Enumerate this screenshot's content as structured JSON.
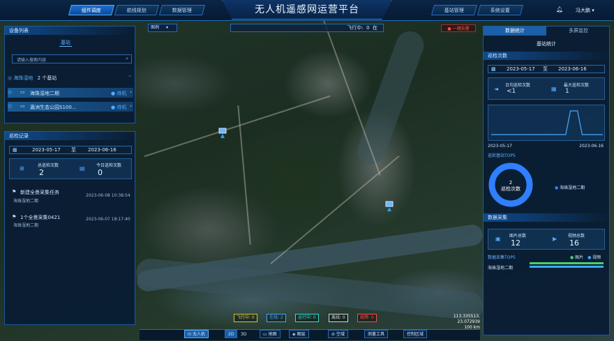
{
  "header": {
    "title": "无人机遥感网运营平台",
    "left_tabs": [
      "组件调度",
      "航线规划",
      "数据管理"
    ],
    "right_tabs": [
      "基站管理",
      "系统设置"
    ],
    "user": "冯大鹏"
  },
  "map_toolbar": {
    "layer_label": "图例",
    "flight_label": "飞行中:",
    "flight_count": "0",
    "flight_suffix": "在",
    "alarm": "一键告警"
  },
  "left_panel": {
    "device_title": "设备列表",
    "device_tab": "基站",
    "search_placeholder": "请输入搜索内容",
    "group_label": "海珠湿地",
    "group_count": "2 个基站",
    "devices": [
      {
        "name": "海珠湿地二期",
        "status": "待机"
      },
      {
        "name": "瀛洲生态公园S100...",
        "status": "待机"
      }
    ],
    "patrol_title": "巡检记录",
    "date_from": "2023-05-17",
    "date_sep": "至",
    "date_to": "2023-06-16",
    "total_label": "总巡检次数",
    "total_value": "2",
    "today_label": "今日巡检次数",
    "today_value": "0",
    "records": [
      {
        "title": "新建全景采集任务",
        "time": "2023-06-08 10:38:54",
        "site": "海珠湿地二期"
      },
      {
        "title": "1个全景采集0421",
        "time": "2023-06-07 18:17:40",
        "site": "海珠湿地二期"
      }
    ]
  },
  "right_panel": {
    "tab_stats": "数据统计",
    "tab_monitor": "多屏监控",
    "sub_title": "基站统计",
    "patrol_count_title": "巡检次数",
    "date_from": "2023-05-17",
    "date_sep": "至",
    "date_to": "2023-06-16",
    "daily_label": "日均巡检次数",
    "daily_value": "<1",
    "max_label": "最大巡检次数",
    "max_value": "1",
    "axis_start": "2023-05-17",
    "axis_end": "2023-06-16",
    "top5_title": "巡检基站TOP5",
    "donut_value": "2",
    "donut_label": "巡检次数",
    "donut_legend": "海珠湿地二期",
    "data_title": "数据采集",
    "image_label": "图片总数",
    "image_value": "12",
    "video_label": "视频总数",
    "video_value": "16",
    "collect_top5": "数据采集TOP5",
    "legend_image": "图片",
    "legend_video": "视频",
    "collect_site": "海珠湿地二期"
  },
  "bottom": {
    "stats": [
      {
        "label": "飞行中: 0",
        "color": "#d8c33a"
      },
      {
        "label": "在线: 2",
        "color": "#3fa8ff"
      },
      {
        "label": "运行中: 0",
        "color": "#35e0d8"
      },
      {
        "label": "离线: 0",
        "color": "#cfd6df"
      },
      {
        "label": "故障: 0",
        "color": "#ff4a4a"
      }
    ],
    "coords": "113.335513, 23.072939",
    "scale": "100 km",
    "toolbar": {
      "drone": "无人机",
      "mode2d": "2D",
      "mode3d": "3D",
      "map": "地图",
      "layer": "图层",
      "airspace": "空域",
      "measure": "测量工具",
      "control": "控制区域"
    }
  }
}
